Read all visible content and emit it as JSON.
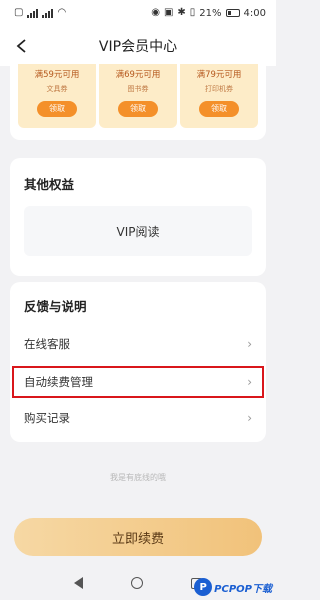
{
  "status_bar": {
    "battery": "21%",
    "time": "4:00"
  },
  "header": {
    "title": "VIP会员中心"
  },
  "coupons": [
    {
      "amount": "满59元可用",
      "type": "文具券",
      "button": "领取"
    },
    {
      "amount": "满69元可用",
      "type": "图书券",
      "button": "领取"
    },
    {
      "amount": "满79元可用",
      "type": "打印机券",
      "button": "领取"
    }
  ],
  "other_benefits": {
    "title": "其他权益",
    "item": "VIP阅读"
  },
  "feedback": {
    "title": "反馈与说明",
    "items": [
      "在线客服",
      "自动续费管理",
      "购买记录"
    ]
  },
  "bottom_line": "我是有底线的哦",
  "renew_button": "立即续费",
  "watermark": {
    "text": "PCPOP下载"
  }
}
